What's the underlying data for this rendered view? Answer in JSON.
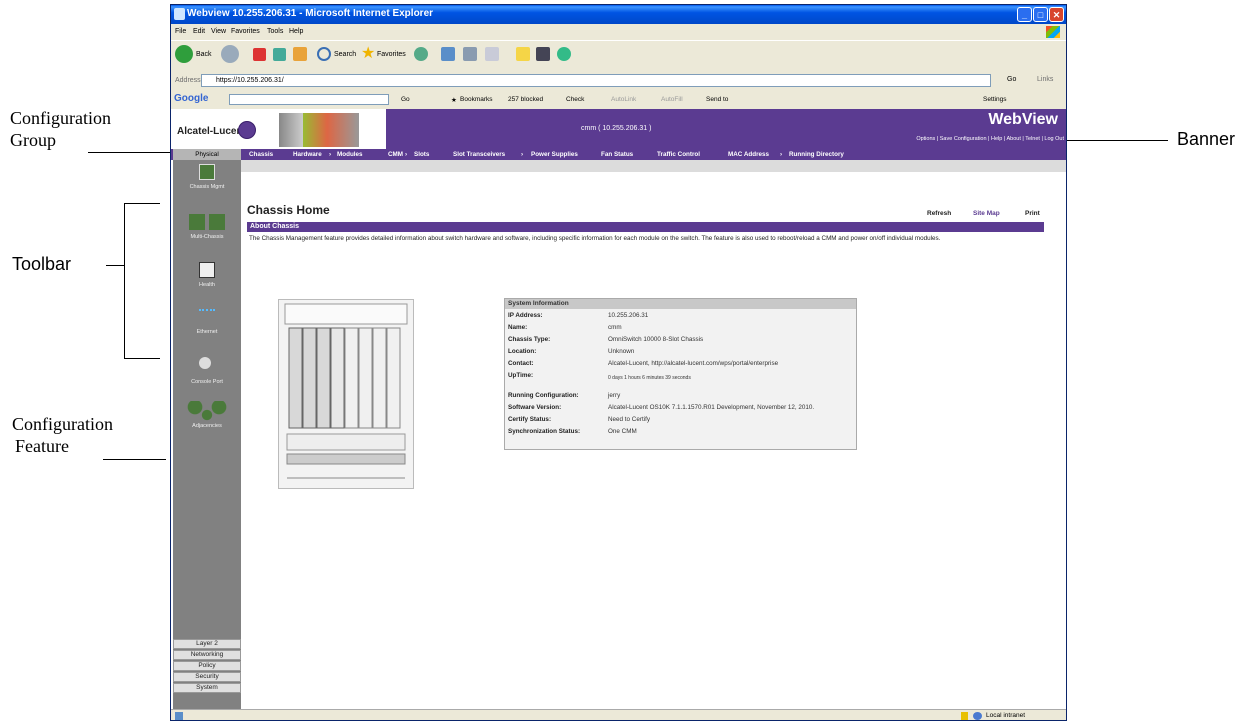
{
  "callouts": {
    "configuration_group_line1": "Configuration",
    "configuration_group_line2": "Group",
    "toolbar": "Toolbar",
    "configuration_feature_line1": "Configuration",
    "configuration_feature_line2": "Feature",
    "banner": "Banner"
  },
  "browser": {
    "title": "Webview  10.255.206.31 - Microsoft Internet Explorer",
    "menu": [
      "File",
      "Edit",
      "View",
      "Favorites",
      "Tools",
      "Help"
    ],
    "toolbar": {
      "back": "Back",
      "search": "Search",
      "favorites": "Favorites"
    },
    "address_label": "Address",
    "address_value": "https://10.255.206.31/",
    "go": "Go",
    "links": "Links",
    "google": {
      "logo": "Google",
      "go": "Go",
      "bookmarks": "Bookmarks",
      "blocked": "257 blocked",
      "check": "Check",
      "autolink": "AutoLink",
      "autofill": "AutoFill",
      "sendto": "Send to",
      "settings": "Settings"
    },
    "status": {
      "zone": "Local intranet"
    }
  },
  "webview": {
    "logo_text": "Alcatel-Lucent",
    "host": "cmm  ( 10.255.206.31 )",
    "product": "WebView",
    "banner_links": "Options  |  Save Configuration  |  Help  |  About  |  Telnet  |  Log Out",
    "config_group": "Physical",
    "nav": [
      {
        "label": "Chassis",
        "arrow": ""
      },
      {
        "label": "Hardware",
        "arrow": "›"
      },
      {
        "label": "Modules",
        "arrow": ""
      },
      {
        "label": "CMM",
        "arrow": "›"
      },
      {
        "label": "Slots",
        "arrow": ""
      },
      {
        "label": "Slot Transceivers",
        "arrow": "›"
      },
      {
        "label": "Power Supplies",
        "arrow": ""
      },
      {
        "label": "Fan Status",
        "arrow": ""
      },
      {
        "label": "Traffic Control",
        "arrow": ""
      },
      {
        "label": "MAC Address",
        "arrow": "›"
      },
      {
        "label": "Running Directory",
        "arrow": ""
      }
    ],
    "tools": [
      {
        "label": "Chassis Mgmt"
      },
      {
        "label": "Multi-Chassis"
      },
      {
        "label": "Health"
      },
      {
        "label": "Ethernet"
      },
      {
        "label": "Console Port"
      },
      {
        "label": "Adjacencies"
      }
    ],
    "groups": [
      "Layer 2",
      "Networking",
      "Policy",
      "Security",
      "System"
    ],
    "heading": "Chassis Home",
    "links": {
      "refresh": "Refresh",
      "sitemap": "Site Map",
      "print": "Print"
    },
    "about_title": "About Chassis",
    "about_text": "The Chassis Management feature provides detailed information about switch hardware and software, including specific information for each module on the switch. The feature is also used to reboot/reload a CMM and power on/off individual modules.",
    "sysinfo": {
      "title": "System Information",
      "rows": [
        {
          "key": "IP Address:",
          "value": "10.255.206.31"
        },
        {
          "key": "Name:",
          "value": "cmm"
        },
        {
          "key": "Chassis Type:",
          "value": "OmniSwitch 10000 8-Slot Chassis"
        },
        {
          "key": "Location:",
          "value": "Unknown"
        },
        {
          "key": "Contact:",
          "value": "Alcatel-Lucent, http://alcatel-lucent.com/wps/portal/enterprise"
        },
        {
          "key": "UpTime:",
          "value": "0 days 1 hours 6 minutes 39 seconds"
        },
        {
          "key": "Running Configuration:",
          "value": "jerry"
        },
        {
          "key": "Software Version:",
          "value": "Alcatel-Lucent OS10K 7.1.1.1570.R01 Development, November 12, 2010."
        },
        {
          "key": "Certify Status:",
          "value": "Need to Certify"
        },
        {
          "key": "Synchronization Status:",
          "value": "One CMM"
        }
      ]
    }
  }
}
